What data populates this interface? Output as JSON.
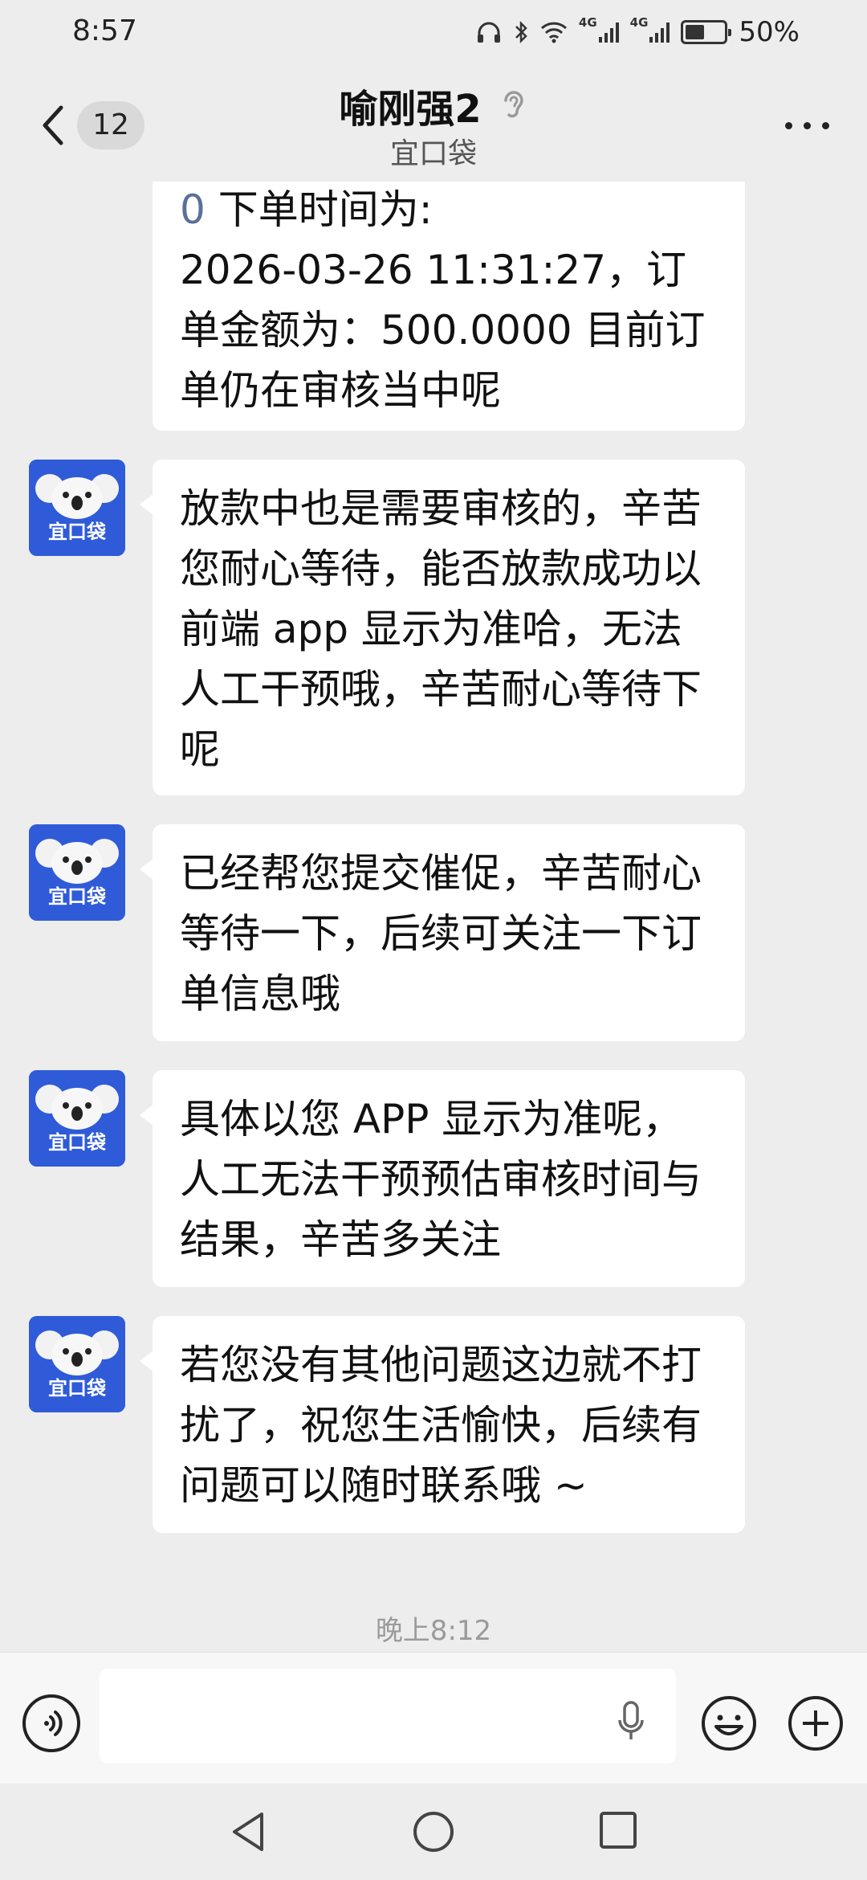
{
  "status_bar": {
    "time": "8:57",
    "network_1": "4G",
    "network_2": "4G",
    "battery_level": 0.5,
    "battery_text": "50%",
    "icons": [
      "headphones-icon",
      "bluetooth-icon",
      "wifi-icon",
      "signal-icon",
      "signal-icon",
      "battery-icon"
    ]
  },
  "header": {
    "back_icon": "chevron-left-icon",
    "unread_count": "12",
    "title": "喻刚强2",
    "title_icon": "ear-icon",
    "subtitle": "宜口袋",
    "more_icon": "more-dots-icon"
  },
  "messages": [
    {
      "sender": "宜口袋",
      "partial": true,
      "accent_prefix": "0",
      "text": " 下单时间为:\n2026-03-26 11:31:27，订单金额为：500.0000 目前订单仍在审核当中呢"
    },
    {
      "sender": "宜口袋",
      "avatar_label": "宜口袋",
      "text": "放款中也是需要审核的，辛苦您耐心等待，能否放款成功以前端 app 显示为准哈，无法人工干预哦，辛苦耐心等待下呢"
    },
    {
      "sender": "宜口袋",
      "avatar_label": "宜口袋",
      "text": "已经帮您提交催促，辛苦耐心等待一下，后续可关注一下订单信息哦"
    },
    {
      "sender": "宜口袋",
      "avatar_label": "宜口袋",
      "text": "具体以您 APP 显示为准呢，人工无法干预预估审核时间与结果，辛苦多关注"
    },
    {
      "sender": "宜口袋",
      "avatar_label": "宜口袋",
      "text": "若您没有其他问题这边就不打扰了，祝您生活愉快，后续有问题可以随时联系哦 ~"
    }
  ],
  "time_divider": "晚上8:12",
  "input_bar": {
    "voice_icon": "voice-icon",
    "placeholder": "",
    "mic_icon": "microphone-icon",
    "emoji_icon": "emoji-icon",
    "plus_icon": "plus-icon"
  },
  "nav_bar": {
    "icons": [
      "nav-back-icon",
      "nav-home-icon",
      "nav-recent-icon"
    ]
  },
  "colors": {
    "background": "#ededed",
    "bubble": "#ffffff",
    "accent_text": "#5a7099",
    "avatar": "#2f5bd9"
  }
}
